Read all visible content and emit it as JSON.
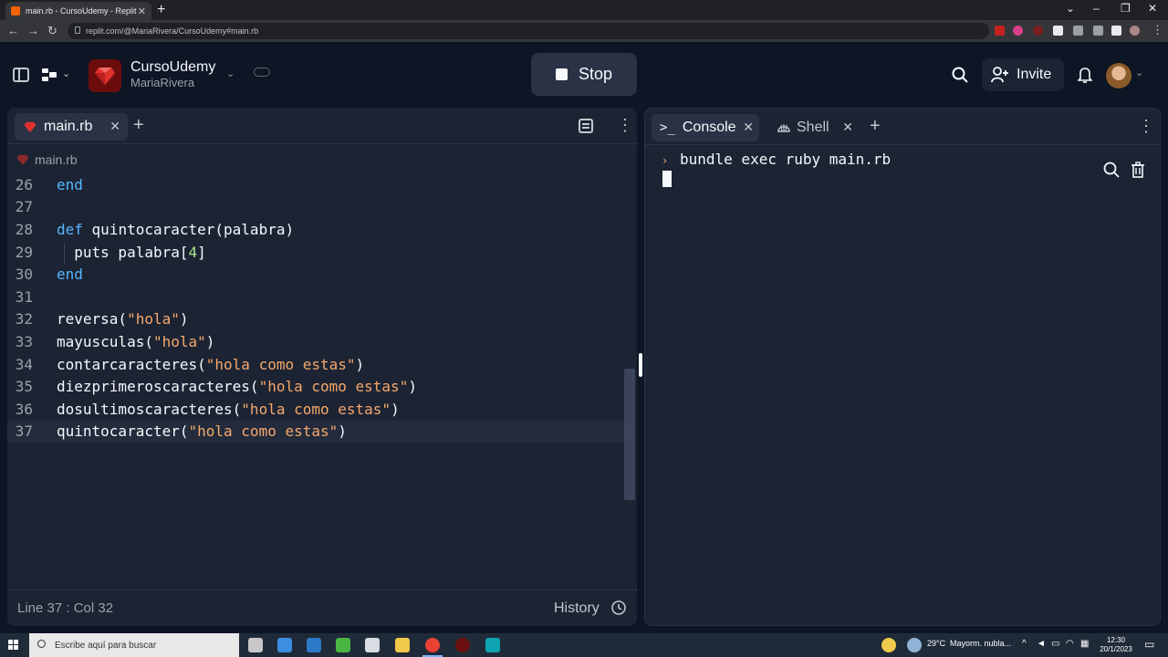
{
  "browser": {
    "tab_title": "main.rb - CursoUdemy - Replit",
    "url": "replit.com/@MariaRivera/CursoUdemy#main.rb"
  },
  "header": {
    "repl_title": "CursoUdemy",
    "repl_owner": "MariaRivera",
    "run_label": "Stop",
    "invite_label": "Invite"
  },
  "editor": {
    "tab_label": "main.rb",
    "breadcrumb": "main.rb",
    "lines": [
      {
        "n": "26"
      },
      {
        "n": "27"
      },
      {
        "n": "28"
      },
      {
        "n": "29"
      },
      {
        "n": "30"
      },
      {
        "n": "31"
      },
      {
        "n": "32"
      },
      {
        "n": "33"
      },
      {
        "n": "34"
      },
      {
        "n": "35"
      },
      {
        "n": "36"
      },
      {
        "n": "37"
      }
    ],
    "code": {
      "l26_kw": "end",
      "l28_kw": "def",
      "l28_rest": " quintocaracter(palabra)",
      "l29_a": "  puts palabra[",
      "l29_num": "4",
      "l29_b": "]",
      "l30_kw": "end",
      "l32_a": "reversa(",
      "l32_str": "\"hola\"",
      "l32_b": ")",
      "l33_a": "mayusculas(",
      "l33_str": "\"hola\"",
      "l33_b": ")",
      "l34_a": "contarcaracteres(",
      "l34_str": "\"hola como estas\"",
      "l34_b": ")",
      "l35_a": "diezprimeroscaracteres(",
      "l35_str": "\"hola como estas\"",
      "l35_b": ")",
      "l36_a": "dosultimoscaracteres(",
      "l36_str": "\"hola como estas\"",
      "l36_b": ")",
      "l37_a": "quintocaracter(",
      "l37_str": "\"hola como estas\"",
      "l37_b": ")"
    },
    "cursor_position": "Line 37 : Col 32",
    "history_label": "History"
  },
  "console": {
    "tab_console": "Console",
    "tab_shell": "Shell",
    "command": "bundle exec ruby main.rb"
  },
  "taskbar": {
    "search_placeholder": "Escribe aquí para buscar",
    "weather_temp": "29°C",
    "weather_desc": "Mayorm. nubla...",
    "time": "12:30",
    "date": "20/1/2023"
  },
  "colors": {
    "accent_keyword": "#56b6ff",
    "string": "#f5a86b",
    "number": "#a7e58b",
    "background": "#0e1525",
    "panel": "#1c2333"
  },
  "icons": [
    "sidebar-toggle-icon",
    "workspace-icon",
    "ruby-icon",
    "cloud-icon",
    "search-icon",
    "invite-icon",
    "bell-icon",
    "outline-icon",
    "history-icon",
    "terminal-icon",
    "shell-icon",
    "trash-icon"
  ]
}
